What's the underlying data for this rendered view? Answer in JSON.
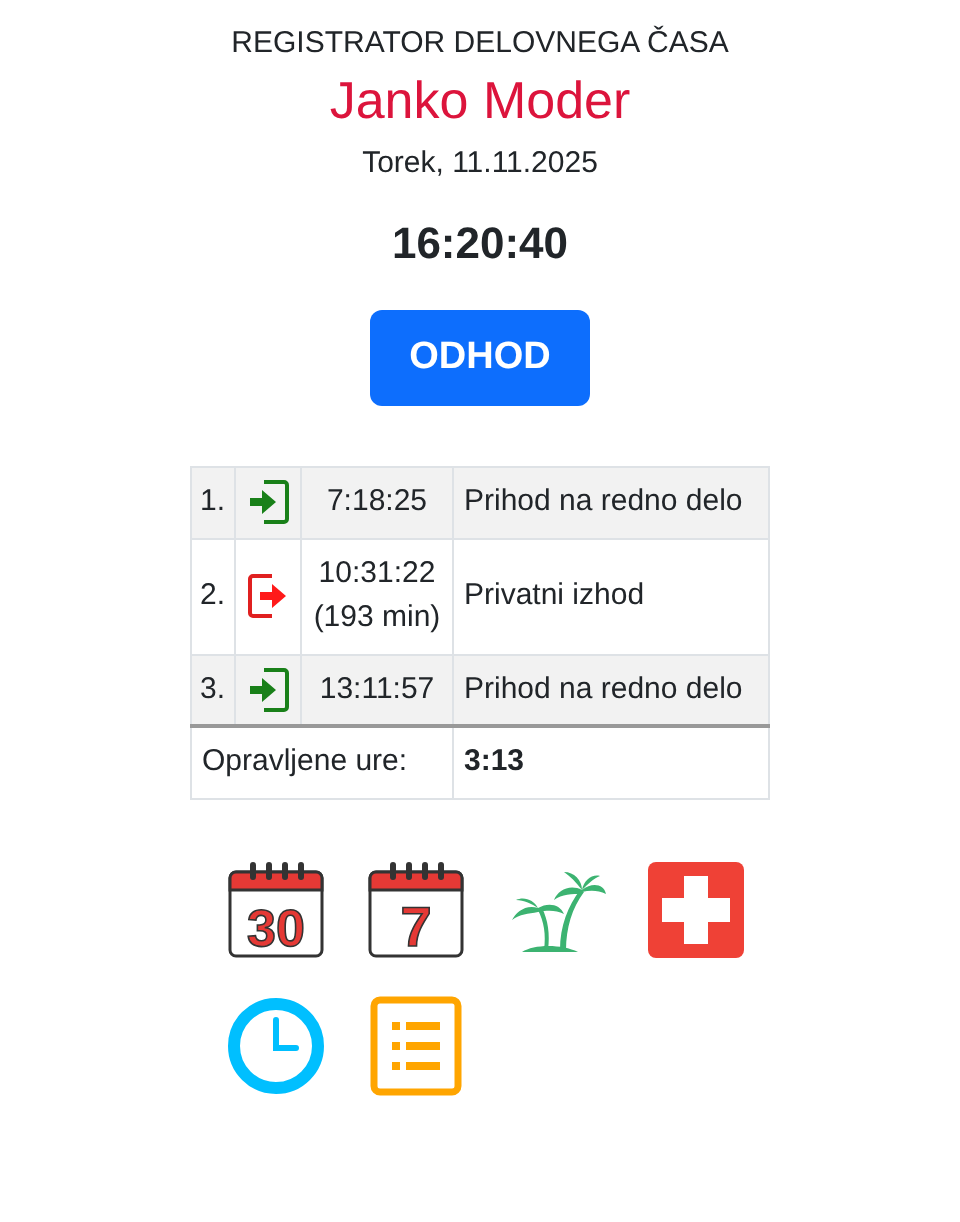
{
  "header": {
    "title": "REGISTRATOR DELOVNEGA ČASA",
    "name": "Janko Moder",
    "date": "Torek, 11.11.2025",
    "clock": "16:20:40"
  },
  "action_button": "ODHOD",
  "entries": [
    {
      "number": "1.",
      "kind": "in",
      "time": "7:18:25",
      "description": "Prihod na redno delo"
    },
    {
      "number": "2.",
      "kind": "out",
      "time": "10:31:22",
      "duration": "(193 min)",
      "description": "Privatni izhod"
    },
    {
      "number": "3.",
      "kind": "in",
      "time": "13:11:57",
      "description": "Prihod na redno delo"
    }
  ],
  "summary": {
    "label": "Opravljene ure:",
    "value": "3:13"
  },
  "shortcuts": [
    {
      "kind": "calendar",
      "label": "30"
    },
    {
      "kind": "calendar",
      "label": "7"
    },
    {
      "kind": "palm"
    },
    {
      "kind": "cross"
    },
    {
      "kind": "clock"
    },
    {
      "kind": "list"
    }
  ]
}
